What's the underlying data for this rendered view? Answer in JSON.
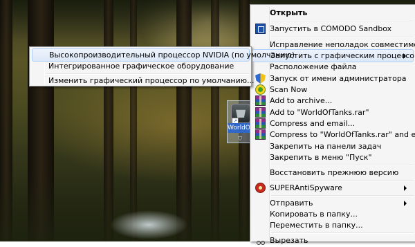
{
  "desktop": {
    "icon_label": "WorldOfT",
    "icon_name": "world-of-tanks-icon"
  },
  "main_menu": {
    "open": "Открыть",
    "comodo": "Запустить в COMODO Sandbox",
    "compat": "Исправление неполадок совместимости",
    "gpu": "Запустить с графическим процессором",
    "location": "Расположение файла",
    "admin": "Запуск от имени администратора",
    "scan": "Scan Now",
    "add_archive": "Add to archive...",
    "add_rar": "Add to \"WorldOfTanks.rar\"",
    "compress_email": "Compress and email...",
    "compress_rar_email": "Compress to \"WorldOfTanks.rar\" and email",
    "pin_taskbar": "Закрепить на панели задач",
    "pin_start": "Закрепить в меню \"Пуск\"",
    "restore": "Восстановить прежнюю версию",
    "superantispyware": "SUPERAntiSpyware",
    "send_to": "Отправить",
    "copy_to": "Копировать в папку...",
    "move_to": "Переместить в папку...",
    "cut": "Вырезать"
  },
  "sub_menu": {
    "nvidia": "Высокопроизводительный процессор NVIDIA (по умолчанию)",
    "integrated": "Интегрированное графическое оборудование",
    "change_default": "Изменить графический процессор по умолчанию..."
  },
  "colors": {
    "menu_bg": "#f5f5f5",
    "highlight_border": "#aecff7",
    "selection_blue": "#3168c6"
  }
}
